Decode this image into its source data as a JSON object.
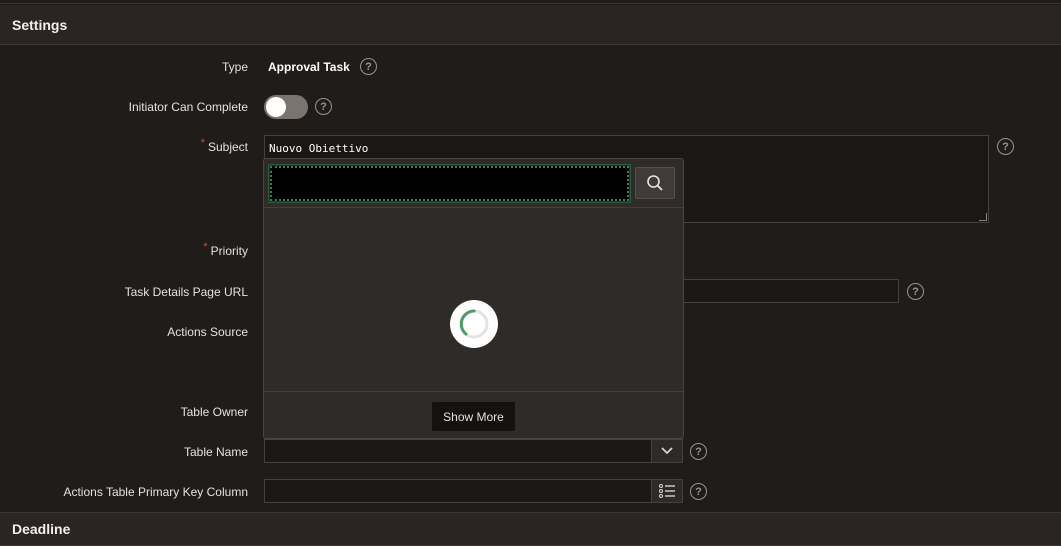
{
  "sections": {
    "settings": "Settings",
    "deadline": "Deadline"
  },
  "fields": {
    "type": {
      "label": "Type",
      "value": "Approval Task"
    },
    "initiator_can_complete": {
      "label": "Initiator Can Complete",
      "state": "off"
    },
    "subject": {
      "label": "Subject",
      "value": "Nuovo Obiettivo",
      "required_mark": "*"
    },
    "priority": {
      "label": "Priority",
      "required_mark": "*"
    },
    "task_details_page_url": {
      "label": "Task Details Page URL"
    },
    "actions_source": {
      "label": "Actions Source"
    },
    "table_owner": {
      "label": "Table Owner"
    },
    "table_name": {
      "label": "Table Name",
      "value": ""
    },
    "actions_table_pk_column": {
      "label": "Actions Table Primary Key Column",
      "value": ""
    }
  },
  "help_glyph": "?",
  "popup": {
    "search_value": "",
    "search_icon": "search-icon",
    "loading_icon": "spinner-icon",
    "show_more_label": "Show More"
  },
  "colors": {
    "background": "#201c1a",
    "header": "#2a2523",
    "required": "#e0483a",
    "focus_ring": "#3f7a57"
  }
}
